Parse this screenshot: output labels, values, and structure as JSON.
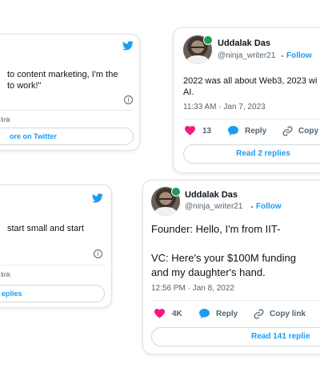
{
  "colors": {
    "blue": "#1d9bf0",
    "heart": "#f91880",
    "meta": "#536471"
  },
  "card_a": {
    "text_line1": "to content marketing, I'm the",
    "text_line2": "to work!\"",
    "link_tail": "link",
    "pill_label": "ore on Twitter"
  },
  "card_b": {
    "author_name": "Uddalak Das",
    "handle": "@ninja_writer21",
    "follow_label": "Follow",
    "text_line1": "2022 was all about Web3, 2023 wi",
    "text_line2": "AI.",
    "timestamp": "11:33 AM · Jan 7, 2023",
    "likes": "13",
    "reply_label": "Reply",
    "copy_label": "Copy",
    "pill_label": "Read 2 replies"
  },
  "card_c": {
    "text_line1": "start small and start",
    "link_tail": "link",
    "pill_label": "eplies"
  },
  "card_d": {
    "author_name": "Uddalak Das",
    "handle": "@ninja_writer21",
    "follow_label": "Follow",
    "text_line1": "Founder: Hello, I'm from IIT-",
    "text_line2": "VC: Here's your $100M funding",
    "text_line3": "and my daughter's hand.",
    "timestamp": "12:56 PM · Jan 8, 2022",
    "likes": "4K",
    "reply_label": "Reply",
    "copy_label": "Copy link",
    "pill_label": "Read 141 replie"
  },
  "icons": {
    "bird": "twitter-bird-icon",
    "info": "info-icon",
    "heart": "heart-icon",
    "reply": "speech-bubble-icon",
    "link": "link-icon"
  }
}
